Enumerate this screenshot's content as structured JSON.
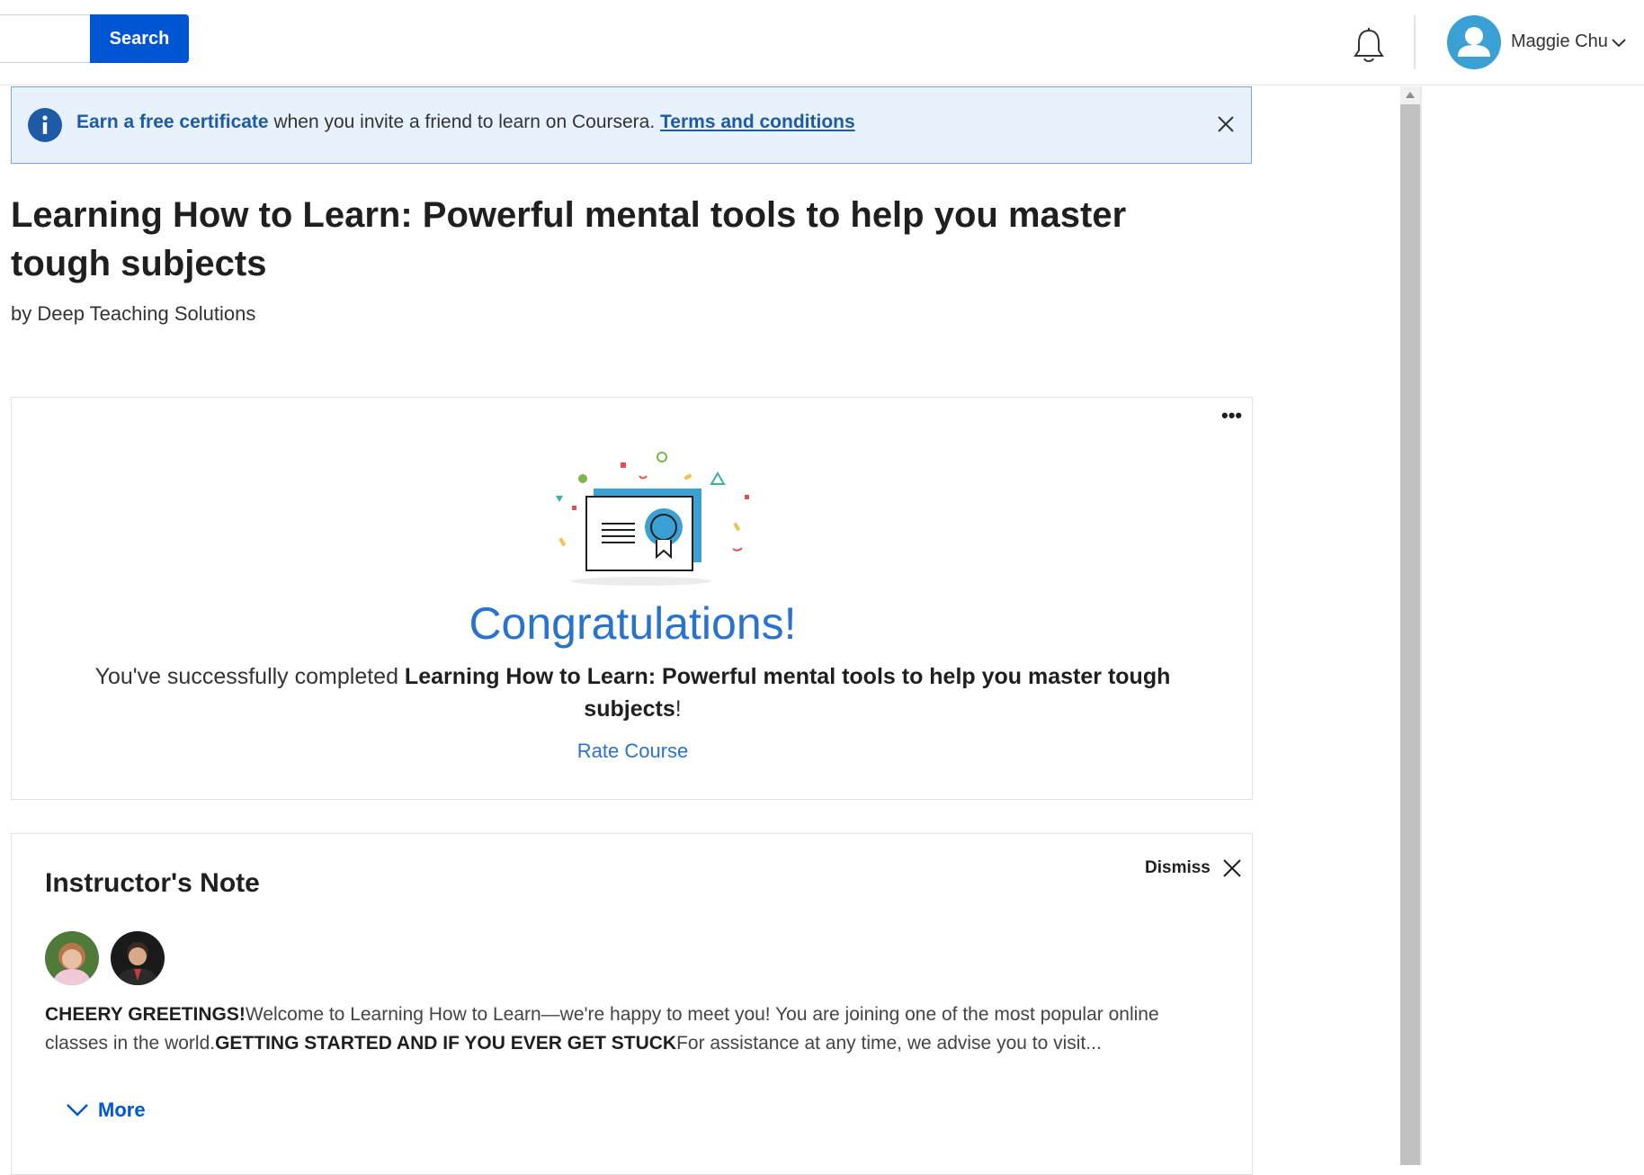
{
  "header": {
    "search_placeholder": "",
    "search_button_label": "Search",
    "user_name": "Maggie Chu"
  },
  "banner": {
    "highlight": "Earn a free certificate",
    "text": " when you invite a friend to learn on Coursera. ",
    "link": "Terms and conditions"
  },
  "course": {
    "title": "Learning How to Learn: Powerful mental tools to help you master tough subjects",
    "by": "by Deep Teaching Solutions"
  },
  "completion": {
    "heading": "Congratulations!",
    "prefix": "You've successfully completed ",
    "course_name": "Learning How to Learn: Powerful mental tools to help you master tough subjects",
    "suffix": "!",
    "rate_link": "Rate Course",
    "menu_glyph": "•••"
  },
  "instructor_note": {
    "title": "Instructor's Note",
    "dismiss_label": "Dismiss",
    "greeting_bold": "CHEERY GREETINGS!",
    "greeting_text": "Welcome to Learning How to Learn—we're happy to meet you! You are joining one of the most popular online classes in the world.",
    "started_bold": "GETTING STARTED AND IF YOU EVER GET STUCK",
    "started_text": "For assistance at any time, we advise you to visit...",
    "more_label": "More"
  },
  "colors": {
    "primary": "#0056d2",
    "link": "#2a73cc",
    "banner_bg": "#e8f2fd",
    "avatar": "#3ba0d4"
  },
  "icons": {
    "bell": "bell-icon",
    "info": "info-icon",
    "close": "close-icon",
    "chevron": "chevron-down-icon",
    "more": "more-horizontal-icon",
    "certificate": "certificate-illustration"
  }
}
